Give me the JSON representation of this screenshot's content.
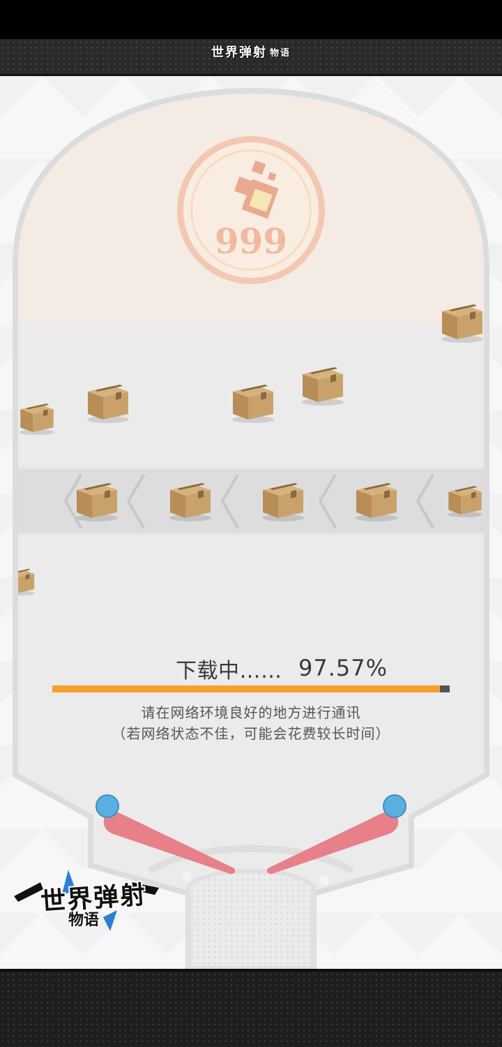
{
  "header": {
    "logo_text": "世界弹射",
    "logo_sub": "物语"
  },
  "emblem": {
    "count": "999"
  },
  "loading": {
    "label": "下载中……",
    "percent": "97.57%",
    "progress": 0.9757,
    "notice_line1": "请在网络环境良好的地方进行通讯",
    "notice_line2": "（若网络状态不佳，可能会花费较长时间）"
  },
  "corner_logo": {
    "text": "世界弹射",
    "sub": "物语"
  },
  "colors": {
    "progress_fill": "#f5a12c",
    "progress_track": "#555555",
    "flipper": "#e8808a",
    "flipper_pivot": "#5aafe0",
    "box": "#c9a26b"
  }
}
